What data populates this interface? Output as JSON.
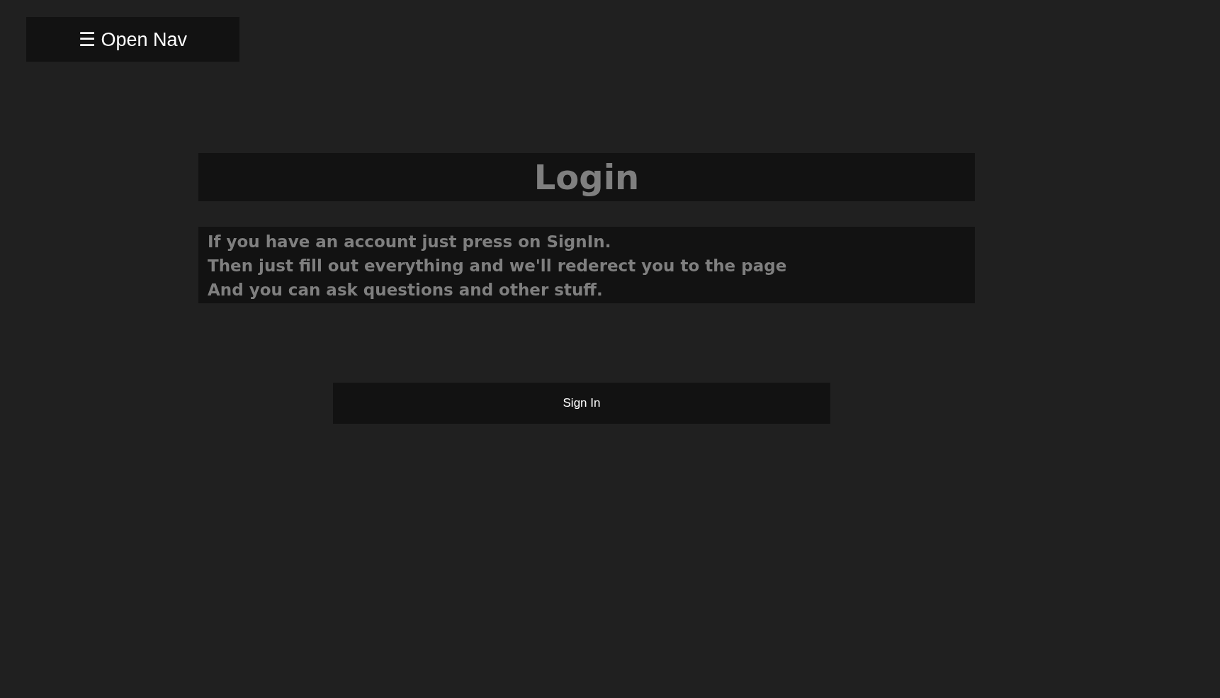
{
  "nav_button": {
    "label": "☰ Open Nav"
  },
  "title": "Login",
  "intro_lines": [
    "If you have an account just press on SignIn.",
    "Then just fill out everything and we'll rederect you to the page",
    "And you can ask questions and other stuff."
  ],
  "sign_in_button": {
    "label": "Sign In"
  }
}
